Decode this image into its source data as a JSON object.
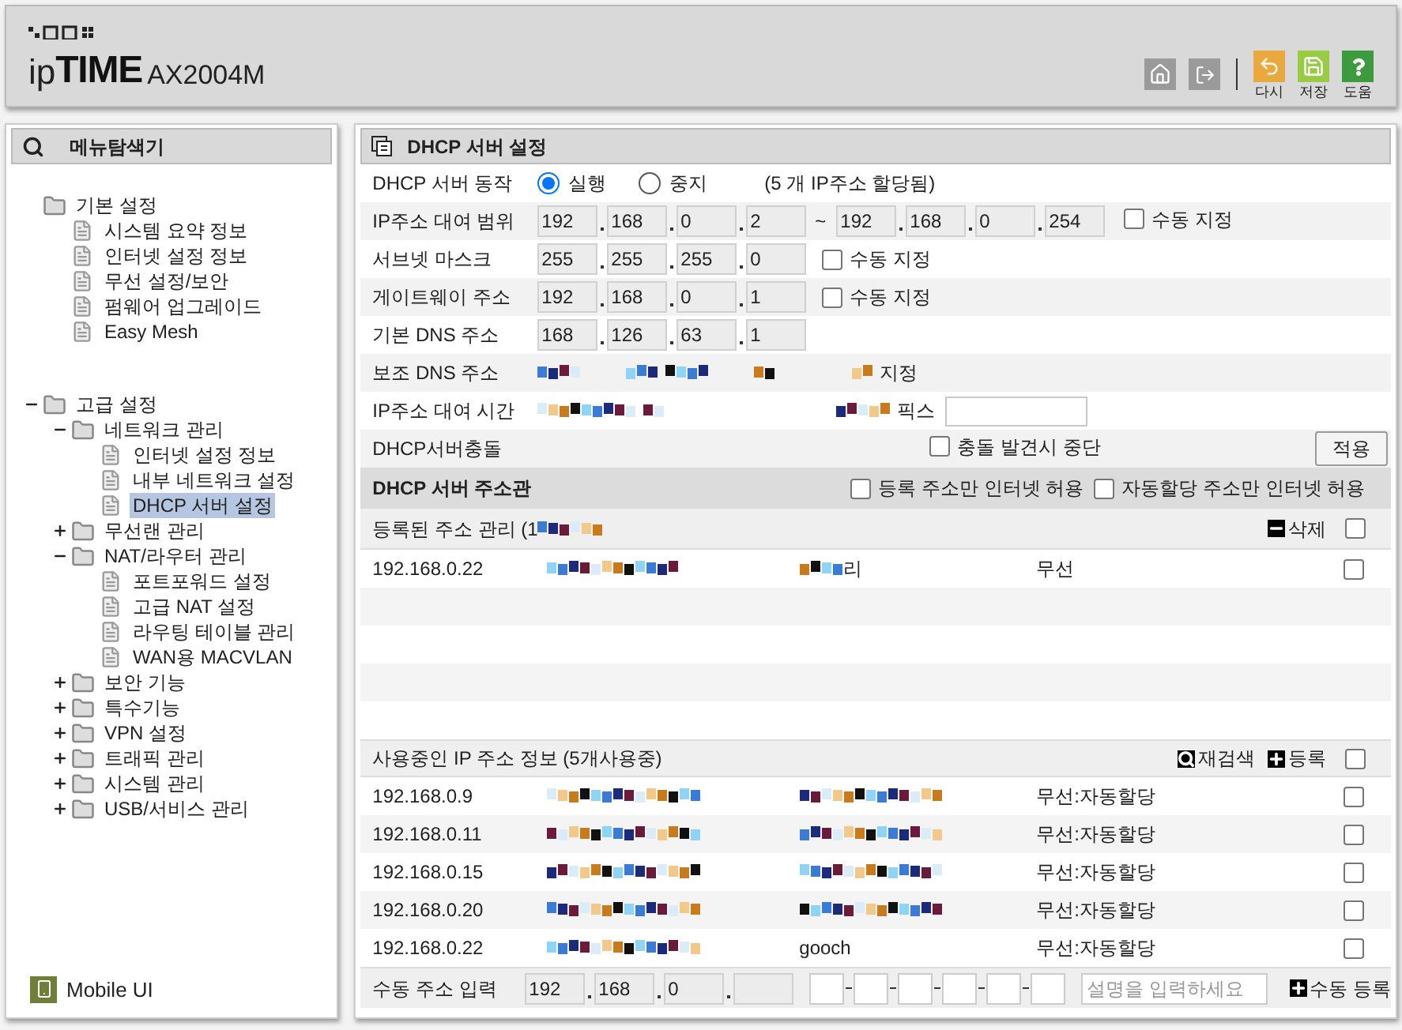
{
  "header": {
    "logo_prefix": "ip",
    "logo_brand": "TIME",
    "model": "AX2004M",
    "actions": [
      {
        "kind": "undo",
        "label": "다시",
        "color": "#e9a93f"
      },
      {
        "kind": "save",
        "label": "저장",
        "color": "#9acb45"
      },
      {
        "kind": "help",
        "label": "도움",
        "color": "#3d9a3d"
      }
    ]
  },
  "sidebar": {
    "title": "메뉴탐색기",
    "tree": [
      {
        "label": "기본 설정",
        "selected": false,
        "children": [
          {
            "label": "시스템 요약 정보",
            "selected": false
          },
          {
            "label": "인터넷 설정 정보",
            "selected": false
          },
          {
            "label": "무선 설정/보안",
            "selected": false
          },
          {
            "label": "펌웨어 업그레이드",
            "selected": false
          },
          {
            "label": "Easy Mesh",
            "selected": false
          }
        ]
      },
      {
        "label": "고급 설정",
        "selected": false,
        "expanded": true,
        "children": [
          {
            "label": "네트워크 관리",
            "selected": false,
            "expanded": true,
            "children": [
              {
                "label": "인터넷 설정 정보",
                "selected": false
              },
              {
                "label": "내부 네트워크 설정",
                "selected": false
              },
              {
                "label": "DHCP 서버 설정",
                "selected": true
              }
            ]
          },
          {
            "label": "무선랜 관리",
            "selected": false,
            "expanded": false
          },
          {
            "label": "NAT/라우터 관리",
            "selected": false,
            "expanded": true,
            "children": [
              {
                "label": "포트포워드 설정",
                "selected": false
              },
              {
                "label": "고급 NAT 설정",
                "selected": false
              },
              {
                "label": "라우팅 테이블 관리",
                "selected": false
              },
              {
                "label": "WAN용 MACVLAN",
                "selected": false
              }
            ]
          },
          {
            "label": "보안 기능",
            "selected": false,
            "expanded": false
          },
          {
            "label": "특수기능",
            "selected": false,
            "expanded": false
          },
          {
            "label": "VPN 설정",
            "selected": false,
            "expanded": false
          },
          {
            "label": "트래픽 관리",
            "selected": false,
            "expanded": false
          },
          {
            "label": "시스템 관리",
            "selected": false,
            "expanded": false
          },
          {
            "label": "USB/서비스 관리",
            "selected": false,
            "expanded": false
          }
        ]
      }
    ],
    "footer": "Mobile UI"
  },
  "panel": {
    "title": "DHCP 서버 설정",
    "form": [
      {
        "kind": "radio",
        "label": "DHCP 서버 동작",
        "options": [
          {
            "label": "실행",
            "selected": true
          },
          {
            "label": "중지",
            "selected": false
          }
        ],
        "note": "(5 개 IP주소 할당됨)"
      },
      {
        "kind": "ip_range",
        "label": "IP주소 대여 범위",
        "from": [
          "192",
          "168",
          "0",
          "2"
        ],
        "separator": "~",
        "to": [
          "192",
          "168",
          "0",
          "254"
        ],
        "checkbox": {
          "label": "수동 지정",
          "checked": false
        }
      },
      {
        "kind": "ip",
        "label": "서브넷 마스크",
        "octets": [
          "255",
          "255",
          "255",
          "0"
        ],
        "checkbox": {
          "label": "수동 지정",
          "checked": false
        }
      },
      {
        "kind": "ip",
        "label": "게이트웨이 주소",
        "octets": [
          "192",
          "168",
          "0",
          "1"
        ],
        "checkbox": {
          "label": "수동 지정",
          "checked": false
        }
      },
      {
        "kind": "ip",
        "label": "기본 DNS 주소",
        "octets": [
          "168",
          "126",
          "63",
          "1"
        ]
      },
      {
        "kind": "masked",
        "label": "보조 DNS 주소",
        "suffix": "지정"
      },
      {
        "kind": "masked_input",
        "label": "IP주소 대여 시간",
        "suffix": "픽스"
      },
      {
        "kind": "conflict",
        "label": "DHCP서버충돌",
        "checkbox": {
          "label": "충돌 발견시 중단",
          "checked": false
        },
        "button": "적용"
      }
    ]
  },
  "address_management": {
    "title": "DHCP 서버 주소관",
    "options": [
      {
        "label": "등록 주소만 인터넷 허용",
        "checked": false
      },
      {
        "label": "자동할당 주소만 인터넷 허용",
        "checked": false
      }
    ],
    "registered": {
      "title": "등록된 주소 관리 (1",
      "action": "삭제",
      "all_checked": false,
      "rows": [
        {
          "ip": "192.168.0.22",
          "name": "리",
          "type": "무선",
          "checked": false
        }
      ]
    },
    "in_use": {
      "title": "사용중인 IP 주소 정보 (5개사용중)",
      "all_checked": false,
      "actions": [
        {
          "kind": "search",
          "label": "재검색"
        },
        {
          "kind": "add",
          "label": "등록"
        }
      ],
      "rows": [
        {
          "ip": "192.168.0.9",
          "type": "무선:자동할당",
          "checked": false
        },
        {
          "ip": "192.168.0.11",
          "type": "무선:자동할당",
          "checked": false
        },
        {
          "ip": "192.168.0.15",
          "type": "무선:자동할당",
          "checked": false
        },
        {
          "ip": "192.168.0.20",
          "type": "무선:자동할당",
          "checked": false
        },
        {
          "ip": "192.168.0.22",
          "name": "gooch",
          "type": "무선:자동할당",
          "checked": false
        }
      ]
    },
    "manual_entry": {
      "label": "수동 주소 입력",
      "octets": [
        "192",
        "168",
        "0"
      ],
      "placeholder": "설명을 입력하세요",
      "button": "수동 등록"
    }
  }
}
